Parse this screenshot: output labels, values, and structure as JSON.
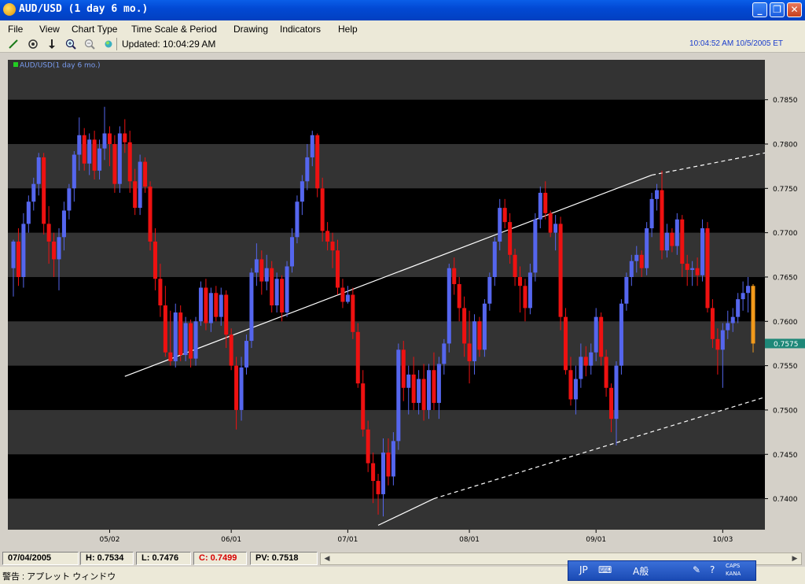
{
  "window": {
    "title": "AUD/USD (1 day  6 mo.)",
    "minimize_symbol": "_",
    "maximize_symbol": "❐",
    "close_symbol": "✕"
  },
  "menu": [
    "File",
    "View",
    "Chart Type",
    "Time Scale & Period",
    "Drawing",
    "Indicators",
    "Help"
  ],
  "toolbar": {
    "icons": [
      "pencil-icon",
      "target-icon",
      "arrow-down-icon",
      "zoom-in-icon",
      "zoom-out-icon",
      "globe-icon"
    ],
    "updated_label": "Updated: 10:04:29 AM",
    "clock": "10:04:52 AM 10/5/2005 ET"
  },
  "chart_data": {
    "type": "candlestick",
    "legend": "AUD/USD(1 day  6 mo.)",
    "x_tick_labels": [
      "05/02",
      "06/01",
      "07/01",
      "08/01",
      "09/01",
      "10/03"
    ],
    "y_tick_labels": [
      "0.7850",
      "0.7800",
      "0.7750",
      "0.7700",
      "0.7650",
      "0.7600",
      "0.7550",
      "0.7500",
      "0.7450",
      "0.7400"
    ],
    "ylim": [
      0.7365,
      0.7895
    ],
    "current_price": "0.7575",
    "colors": {
      "background": "#000000",
      "band": "#333333",
      "up": "#5566ee",
      "down": "#ee1111",
      "current": "#f29a1b",
      "price_tag": "#1e8878",
      "trendline": "#ffffff"
    },
    "candles": [
      {
        "o": 0.766,
        "h": 0.7692,
        "l": 0.7628,
        "c": 0.769
      },
      {
        "o": 0.769,
        "h": 0.7705,
        "l": 0.764,
        "c": 0.765
      },
      {
        "o": 0.765,
        "h": 0.7722,
        "l": 0.7638,
        "c": 0.771
      },
      {
        "o": 0.771,
        "h": 0.7742,
        "l": 0.77,
        "c": 0.7735
      },
      {
        "o": 0.7735,
        "h": 0.7762,
        "l": 0.7725,
        "c": 0.7755
      },
      {
        "o": 0.7755,
        "h": 0.779,
        "l": 0.7742,
        "c": 0.7785
      },
      {
        "o": 0.7785,
        "h": 0.779,
        "l": 0.7698,
        "c": 0.771
      },
      {
        "o": 0.771,
        "h": 0.773,
        "l": 0.7665,
        "c": 0.769
      },
      {
        "o": 0.769,
        "h": 0.77,
        "l": 0.765,
        "c": 0.767
      },
      {
        "o": 0.767,
        "h": 0.7705,
        "l": 0.7635,
        "c": 0.7695
      },
      {
        "o": 0.7695,
        "h": 0.7735,
        "l": 0.768,
        "c": 0.7725
      },
      {
        "o": 0.7725,
        "h": 0.7755,
        "l": 0.7715,
        "c": 0.775
      },
      {
        "o": 0.775,
        "h": 0.7792,
        "l": 0.7735,
        "c": 0.7788
      },
      {
        "o": 0.7788,
        "h": 0.783,
        "l": 0.777,
        "c": 0.781
      },
      {
        "o": 0.781,
        "h": 0.7818,
        "l": 0.777,
        "c": 0.7778
      },
      {
        "o": 0.7778,
        "h": 0.7812,
        "l": 0.7765,
        "c": 0.7805
      },
      {
        "o": 0.7805,
        "h": 0.7815,
        "l": 0.776,
        "c": 0.777
      },
      {
        "o": 0.777,
        "h": 0.7805,
        "l": 0.776,
        "c": 0.7795
      },
      {
        "o": 0.7795,
        "h": 0.7842,
        "l": 0.7782,
        "c": 0.7812
      },
      {
        "o": 0.7812,
        "h": 0.782,
        "l": 0.7775,
        "c": 0.78
      },
      {
        "o": 0.78,
        "h": 0.781,
        "l": 0.7745,
        "c": 0.7755
      },
      {
        "o": 0.7755,
        "h": 0.782,
        "l": 0.7745,
        "c": 0.7812
      },
      {
        "o": 0.7812,
        "h": 0.7828,
        "l": 0.779,
        "c": 0.7802
      },
      {
        "o": 0.7802,
        "h": 0.7815,
        "l": 0.7745,
        "c": 0.7758
      },
      {
        "o": 0.7758,
        "h": 0.7772,
        "l": 0.772,
        "c": 0.7728
      },
      {
        "o": 0.7728,
        "h": 0.7788,
        "l": 0.772,
        "c": 0.778
      },
      {
        "o": 0.778,
        "h": 0.7785,
        "l": 0.7745,
        "c": 0.7752
      },
      {
        "o": 0.7752,
        "h": 0.7758,
        "l": 0.768,
        "c": 0.769
      },
      {
        "o": 0.769,
        "h": 0.7705,
        "l": 0.7635,
        "c": 0.7648
      },
      {
        "o": 0.7648,
        "h": 0.7665,
        "l": 0.7605,
        "c": 0.7618
      },
      {
        "o": 0.7618,
        "h": 0.764,
        "l": 0.756,
        "c": 0.7565
      },
      {
        "o": 0.7565,
        "h": 0.7612,
        "l": 0.755,
        "c": 0.7555
      },
      {
        "o": 0.7555,
        "h": 0.762,
        "l": 0.7548,
        "c": 0.761
      },
      {
        "o": 0.761,
        "h": 0.7618,
        "l": 0.7555,
        "c": 0.7562
      },
      {
        "o": 0.7562,
        "h": 0.7605,
        "l": 0.7555,
        "c": 0.7598
      },
      {
        "o": 0.7598,
        "h": 0.7602,
        "l": 0.7548,
        "c": 0.7558
      },
      {
        "o": 0.7558,
        "h": 0.7605,
        "l": 0.755,
        "c": 0.76
      },
      {
        "o": 0.76,
        "h": 0.7645,
        "l": 0.7595,
        "c": 0.7638
      },
      {
        "o": 0.7638,
        "h": 0.7648,
        "l": 0.759,
        "c": 0.7598
      },
      {
        "o": 0.7598,
        "h": 0.7638,
        "l": 0.7588,
        "c": 0.7632
      },
      {
        "o": 0.7632,
        "h": 0.764,
        "l": 0.76,
        "c": 0.7605
      },
      {
        "o": 0.7605,
        "h": 0.7638,
        "l": 0.7595,
        "c": 0.763
      },
      {
        "o": 0.763,
        "h": 0.7635,
        "l": 0.757,
        "c": 0.7585
      },
      {
        "o": 0.7585,
        "h": 0.7592,
        "l": 0.7545,
        "c": 0.755
      },
      {
        "o": 0.755,
        "h": 0.756,
        "l": 0.7478,
        "c": 0.75
      },
      {
        "o": 0.75,
        "h": 0.756,
        "l": 0.7488,
        "c": 0.7548
      },
      {
        "o": 0.7548,
        "h": 0.7585,
        "l": 0.754,
        "c": 0.7578
      },
      {
        "o": 0.7578,
        "h": 0.766,
        "l": 0.757,
        "c": 0.7655
      },
      {
        "o": 0.7655,
        "h": 0.7688,
        "l": 0.764,
        "c": 0.767
      },
      {
        "o": 0.767,
        "h": 0.768,
        "l": 0.763,
        "c": 0.7645
      },
      {
        "o": 0.7645,
        "h": 0.7675,
        "l": 0.7635,
        "c": 0.766
      },
      {
        "o": 0.766,
        "h": 0.7668,
        "l": 0.761,
        "c": 0.7618
      },
      {
        "o": 0.7618,
        "h": 0.7655,
        "l": 0.761,
        "c": 0.7648
      },
      {
        "o": 0.7648,
        "h": 0.7652,
        "l": 0.76,
        "c": 0.761
      },
      {
        "o": 0.761,
        "h": 0.7668,
        "l": 0.7605,
        "c": 0.7662
      },
      {
        "o": 0.7662,
        "h": 0.7705,
        "l": 0.7655,
        "c": 0.7695
      },
      {
        "o": 0.7695,
        "h": 0.7742,
        "l": 0.7688,
        "c": 0.7735
      },
      {
        "o": 0.7735,
        "h": 0.7765,
        "l": 0.772,
        "c": 0.7758
      },
      {
        "o": 0.7758,
        "h": 0.78,
        "l": 0.7748,
        "c": 0.7785
      },
      {
        "o": 0.7785,
        "h": 0.7815,
        "l": 0.7775,
        "c": 0.781
      },
      {
        "o": 0.781,
        "h": 0.7812,
        "l": 0.774,
        "c": 0.775
      },
      {
        "o": 0.775,
        "h": 0.7762,
        "l": 0.769,
        "c": 0.7702
      },
      {
        "o": 0.7702,
        "h": 0.7712,
        "l": 0.768,
        "c": 0.769
      },
      {
        "o": 0.769,
        "h": 0.77,
        "l": 0.766,
        "c": 0.768
      },
      {
        "o": 0.768,
        "h": 0.7692,
        "l": 0.763,
        "c": 0.7638
      },
      {
        "o": 0.7638,
        "h": 0.7648,
        "l": 0.7615,
        "c": 0.7622
      },
      {
        "o": 0.7622,
        "h": 0.764,
        "l": 0.762,
        "c": 0.763
      },
      {
        "o": 0.763,
        "h": 0.7638,
        "l": 0.758,
        "c": 0.7588
      },
      {
        "o": 0.7588,
        "h": 0.7598,
        "l": 0.7525,
        "c": 0.753
      },
      {
        "o": 0.753,
        "h": 0.7545,
        "l": 0.747,
        "c": 0.7478
      },
      {
        "o": 0.7478,
        "h": 0.7488,
        "l": 0.743,
        "c": 0.744
      },
      {
        "o": 0.744,
        "h": 0.7452,
        "l": 0.7395,
        "c": 0.742
      },
      {
        "o": 0.742,
        "h": 0.7428,
        "l": 0.7382,
        "c": 0.7405
      },
      {
        "o": 0.7405,
        "h": 0.7468,
        "l": 0.738,
        "c": 0.7452
      },
      {
        "o": 0.7452,
        "h": 0.7468,
        "l": 0.7415,
        "c": 0.7425
      },
      {
        "o": 0.7425,
        "h": 0.7475,
        "l": 0.7415,
        "c": 0.7465
      },
      {
        "o": 0.7465,
        "h": 0.7575,
        "l": 0.7455,
        "c": 0.7568
      },
      {
        "o": 0.7568,
        "h": 0.7578,
        "l": 0.751,
        "c": 0.7525
      },
      {
        "o": 0.7525,
        "h": 0.755,
        "l": 0.7495,
        "c": 0.754
      },
      {
        "o": 0.754,
        "h": 0.756,
        "l": 0.75,
        "c": 0.7508
      },
      {
        "o": 0.7508,
        "h": 0.7545,
        "l": 0.7495,
        "c": 0.7535
      },
      {
        "o": 0.7535,
        "h": 0.7552,
        "l": 0.7488,
        "c": 0.75
      },
      {
        "o": 0.75,
        "h": 0.7552,
        "l": 0.749,
        "c": 0.7545
      },
      {
        "o": 0.7545,
        "h": 0.7565,
        "l": 0.75,
        "c": 0.7508
      },
      {
        "o": 0.7508,
        "h": 0.756,
        "l": 0.749,
        "c": 0.7552
      },
      {
        "o": 0.7552,
        "h": 0.758,
        "l": 0.754,
        "c": 0.7575
      },
      {
        "o": 0.7575,
        "h": 0.7665,
        "l": 0.7565,
        "c": 0.766
      },
      {
        "o": 0.766,
        "h": 0.7672,
        "l": 0.763,
        "c": 0.7642
      },
      {
        "o": 0.7642,
        "h": 0.765,
        "l": 0.76,
        "c": 0.7615
      },
      {
        "o": 0.7615,
        "h": 0.7628,
        "l": 0.756,
        "c": 0.7575
      },
      {
        "o": 0.7575,
        "h": 0.7612,
        "l": 0.753,
        "c": 0.7555
      },
      {
        "o": 0.7555,
        "h": 0.7608,
        "l": 0.754,
        "c": 0.76
      },
      {
        "o": 0.76,
        "h": 0.7605,
        "l": 0.756,
        "c": 0.7568
      },
      {
        "o": 0.7568,
        "h": 0.7625,
        "l": 0.756,
        "c": 0.762
      },
      {
        "o": 0.762,
        "h": 0.7655,
        "l": 0.7612,
        "c": 0.765
      },
      {
        "o": 0.765,
        "h": 0.7695,
        "l": 0.764,
        "c": 0.769
      },
      {
        "o": 0.769,
        "h": 0.7738,
        "l": 0.768,
        "c": 0.7728
      },
      {
        "o": 0.7728,
        "h": 0.7738,
        "l": 0.7705,
        "c": 0.7712
      },
      {
        "o": 0.7712,
        "h": 0.7722,
        "l": 0.7665,
        "c": 0.7675
      },
      {
        "o": 0.7675,
        "h": 0.7682,
        "l": 0.764,
        "c": 0.765
      },
      {
        "o": 0.765,
        "h": 0.7662,
        "l": 0.761,
        "c": 0.764
      },
      {
        "o": 0.764,
        "h": 0.7648,
        "l": 0.76,
        "c": 0.7615
      },
      {
        "o": 0.7615,
        "h": 0.7665,
        "l": 0.7608,
        "c": 0.7655
      },
      {
        "o": 0.7655,
        "h": 0.7722,
        "l": 0.7645,
        "c": 0.7715
      },
      {
        "o": 0.7715,
        "h": 0.7752,
        "l": 0.7705,
        "c": 0.7745
      },
      {
        "o": 0.7745,
        "h": 0.7758,
        "l": 0.7715,
        "c": 0.7722
      },
      {
        "o": 0.7722,
        "h": 0.7725,
        "l": 0.7695,
        "c": 0.77
      },
      {
        "o": 0.77,
        "h": 0.772,
        "l": 0.768,
        "c": 0.771
      },
      {
        "o": 0.771,
        "h": 0.7718,
        "l": 0.759,
        "c": 0.7605
      },
      {
        "o": 0.7605,
        "h": 0.7615,
        "l": 0.754,
        "c": 0.7545
      },
      {
        "o": 0.7545,
        "h": 0.756,
        "l": 0.7505,
        "c": 0.7512
      },
      {
        "o": 0.7512,
        "h": 0.755,
        "l": 0.7495,
        "c": 0.7535
      },
      {
        "o": 0.7535,
        "h": 0.7575,
        "l": 0.7525,
        "c": 0.756
      },
      {
        "o": 0.756,
        "h": 0.7572,
        "l": 0.7538,
        "c": 0.755
      },
      {
        "o": 0.755,
        "h": 0.7575,
        "l": 0.754,
        "c": 0.7565
      },
      {
        "o": 0.7565,
        "h": 0.7615,
        "l": 0.7555,
        "c": 0.7605
      },
      {
        "o": 0.7605,
        "h": 0.761,
        "l": 0.755,
        "c": 0.756
      },
      {
        "o": 0.756,
        "h": 0.7568,
        "l": 0.7515,
        "c": 0.7525
      },
      {
        "o": 0.7525,
        "h": 0.753,
        "l": 0.7475,
        "c": 0.749
      },
      {
        "o": 0.749,
        "h": 0.7555,
        "l": 0.746,
        "c": 0.755
      },
      {
        "o": 0.755,
        "h": 0.7625,
        "l": 0.754,
        "c": 0.762
      },
      {
        "o": 0.762,
        "h": 0.7655,
        "l": 0.7612,
        "c": 0.765
      },
      {
        "o": 0.765,
        "h": 0.7675,
        "l": 0.764,
        "c": 0.7668
      },
      {
        "o": 0.7668,
        "h": 0.7685,
        "l": 0.7655,
        "c": 0.7675
      },
      {
        "o": 0.7675,
        "h": 0.768,
        "l": 0.765,
        "c": 0.766
      },
      {
        "o": 0.766,
        "h": 0.7712,
        "l": 0.7652,
        "c": 0.7705
      },
      {
        "o": 0.7705,
        "h": 0.7745,
        "l": 0.7695,
        "c": 0.7738
      },
      {
        "o": 0.7738,
        "h": 0.7755,
        "l": 0.7725,
        "c": 0.7748
      },
      {
        "o": 0.7748,
        "h": 0.777,
        "l": 0.767,
        "c": 0.768
      },
      {
        "o": 0.768,
        "h": 0.771,
        "l": 0.7672,
        "c": 0.77
      },
      {
        "o": 0.77,
        "h": 0.7705,
        "l": 0.7678,
        "c": 0.7685
      },
      {
        "o": 0.7685,
        "h": 0.7722,
        "l": 0.7675,
        "c": 0.7715
      },
      {
        "o": 0.7715,
        "h": 0.772,
        "l": 0.765,
        "c": 0.7665
      },
      {
        "o": 0.7665,
        "h": 0.7675,
        "l": 0.764,
        "c": 0.7658
      },
      {
        "o": 0.7658,
        "h": 0.7668,
        "l": 0.764,
        "c": 0.766
      },
      {
        "o": 0.766,
        "h": 0.7672,
        "l": 0.764,
        "c": 0.7652
      },
      {
        "o": 0.7652,
        "h": 0.7715,
        "l": 0.7645,
        "c": 0.7705
      },
      {
        "o": 0.7705,
        "h": 0.7712,
        "l": 0.761,
        "c": 0.7615
      },
      {
        "o": 0.7615,
        "h": 0.7625,
        "l": 0.757,
        "c": 0.758
      },
      {
        "o": 0.758,
        "h": 0.7592,
        "l": 0.754,
        "c": 0.7568
      },
      {
        "o": 0.7568,
        "h": 0.7598,
        "l": 0.7525,
        "c": 0.759
      },
      {
        "o": 0.759,
        "h": 0.7612,
        "l": 0.758,
        "c": 0.7598
      },
      {
        "o": 0.7598,
        "h": 0.7615,
        "l": 0.7588,
        "c": 0.7605
      },
      {
        "o": 0.7605,
        "h": 0.7632,
        "l": 0.7598,
        "c": 0.7625
      },
      {
        "o": 0.7625,
        "h": 0.7645,
        "l": 0.7612,
        "c": 0.7632
      },
      {
        "o": 0.7632,
        "h": 0.765,
        "l": 0.761,
        "c": 0.764
      },
      {
        "o": 0.764,
        "h": 0.7642,
        "l": 0.7565,
        "c": 0.7575
      }
    ],
    "trendlines": [
      {
        "style": "solid",
        "x1": 22,
        "y1": 0.7538,
        "x2": 126,
        "y2": 0.7765
      },
      {
        "style": "dashed",
        "x1": 126,
        "y1": 0.7765,
        "x2": 160,
        "y2": 0.7803
      },
      {
        "style": "solid",
        "x1": 72,
        "y1": 0.737,
        "x2": 83,
        "y2": 0.74
      },
      {
        "style": "dashed",
        "x1": 83,
        "y1": 0.74,
        "x2": 160,
        "y2": 0.7535
      }
    ]
  },
  "status": {
    "date": "07/04/2005",
    "high": "H: 0.7534",
    "low": "L: 0.7476",
    "close": "C: 0.7499",
    "pv": "PV: 0.7518"
  },
  "footer": {
    "message": "警告 : アプレット ウィンドウ"
  },
  "ime": {
    "items": [
      "JP",
      "⌨",
      "A般",
      "✎",
      "?"
    ],
    "caps": "CAPS",
    "kana": "KANA"
  }
}
